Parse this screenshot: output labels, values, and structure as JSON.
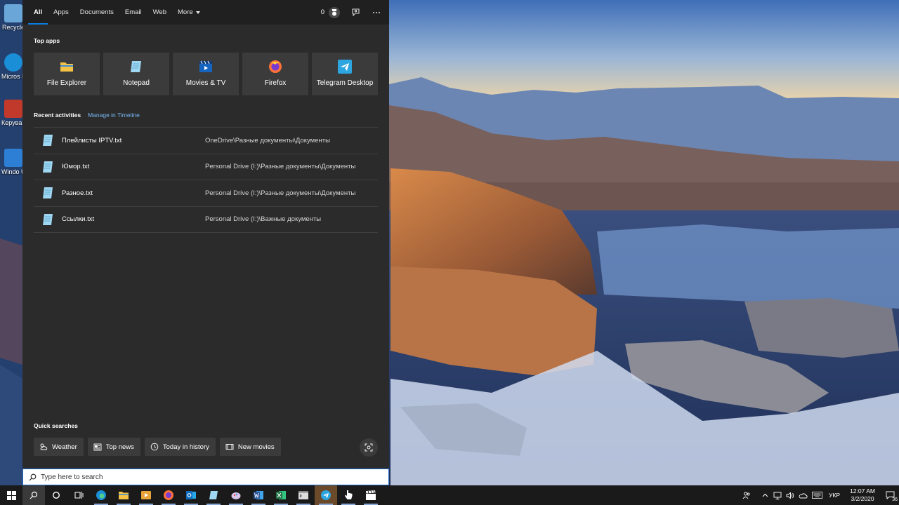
{
  "desktop": {
    "icons": [
      {
        "label": "Recycle",
        "icon": "recycle-bin-icon",
        "color": "#6aa6d8"
      },
      {
        "label": "Micros Edge",
        "icon": "edge-icon",
        "color": "#1a8fd8"
      },
      {
        "label": "Керува систем",
        "icon": "control-icon",
        "color": "#c0392b"
      },
      {
        "label": "Windo Updat",
        "icon": "windows-update-icon",
        "color": "#2d7fd6"
      }
    ]
  },
  "search": {
    "tabs": [
      {
        "label": "All",
        "active": true
      },
      {
        "label": "Apps"
      },
      {
        "label": "Documents"
      },
      {
        "label": "Email"
      },
      {
        "label": "Web"
      },
      {
        "label": "More",
        "has_caret": true
      }
    ],
    "rewards_points": "0",
    "top_apps_title": "Top apps",
    "top_apps": [
      {
        "label": "File Explorer",
        "icon": "folder-icon",
        "color": "#f4c244"
      },
      {
        "label": "Notepad",
        "icon": "notepad-icon",
        "color": "#7fc4e8"
      },
      {
        "label": "Movies & TV",
        "icon": "movies-icon",
        "color": "#1565c0"
      },
      {
        "label": "Firefox",
        "icon": "firefox-icon",
        "color": "#ff7139"
      },
      {
        "label": "Telegram Desktop",
        "icon": "telegram-icon",
        "color": "#2ca5e0"
      }
    ],
    "recent_title": "Recent activities",
    "recent_manage_link": "Manage in Timeline",
    "recent": [
      {
        "name": "Плейлисты IPTV.txt",
        "path": "OneDrive\\Разные документы\\Документы"
      },
      {
        "name": "Юмор.txt",
        "path": "Personal Drive (I:)\\Разные документы\\Документы"
      },
      {
        "name": "Разное.txt",
        "path": "Personal Drive (I:)\\Разные документы\\Документы"
      },
      {
        "name": "Ссылки.txt",
        "path": "Personal Drive (I:)\\Важные документы"
      }
    ],
    "quick_title": "Quick searches",
    "quick": [
      {
        "label": "Weather",
        "icon": "weather-icon"
      },
      {
        "label": "Top news",
        "icon": "news-icon"
      },
      {
        "label": "Today in history",
        "icon": "clock-icon"
      },
      {
        "label": "New movies",
        "icon": "movie-icon"
      }
    ],
    "placeholder": "Type here to search",
    "accent": "#0a7be0"
  },
  "taskbar": {
    "apps": [
      {
        "icon": "task-view-icon",
        "color": "#ffffff"
      },
      {
        "icon": "edge-icon",
        "color": "#1a8fd8"
      },
      {
        "icon": "file-explorer-icon",
        "color": "#f4c244"
      },
      {
        "icon": "media-player-icon",
        "color": "#e8a33a"
      },
      {
        "icon": "firefox-icon",
        "color": "#ff7139"
      },
      {
        "icon": "outlook-icon",
        "color": "#0f6cbd"
      },
      {
        "icon": "notepad-icon",
        "color": "#7fc4e8"
      },
      {
        "icon": "paint-icon",
        "color": "#c8a0e0"
      },
      {
        "icon": "word-icon",
        "color": "#2b579a"
      },
      {
        "icon": "excel-icon",
        "color": "#217346"
      },
      {
        "icon": "terminal-icon",
        "color": "#dddddd"
      },
      {
        "icon": "telegram-icon",
        "color": "#2ca5e0"
      },
      {
        "icon": "pointer-icon",
        "color": "#ffffff"
      },
      {
        "icon": "clapper-icon",
        "color": "#ffffff"
      }
    ],
    "language": "УКР",
    "time": "12:07 AM",
    "date": "3/2/2020",
    "notification_count": "36"
  }
}
